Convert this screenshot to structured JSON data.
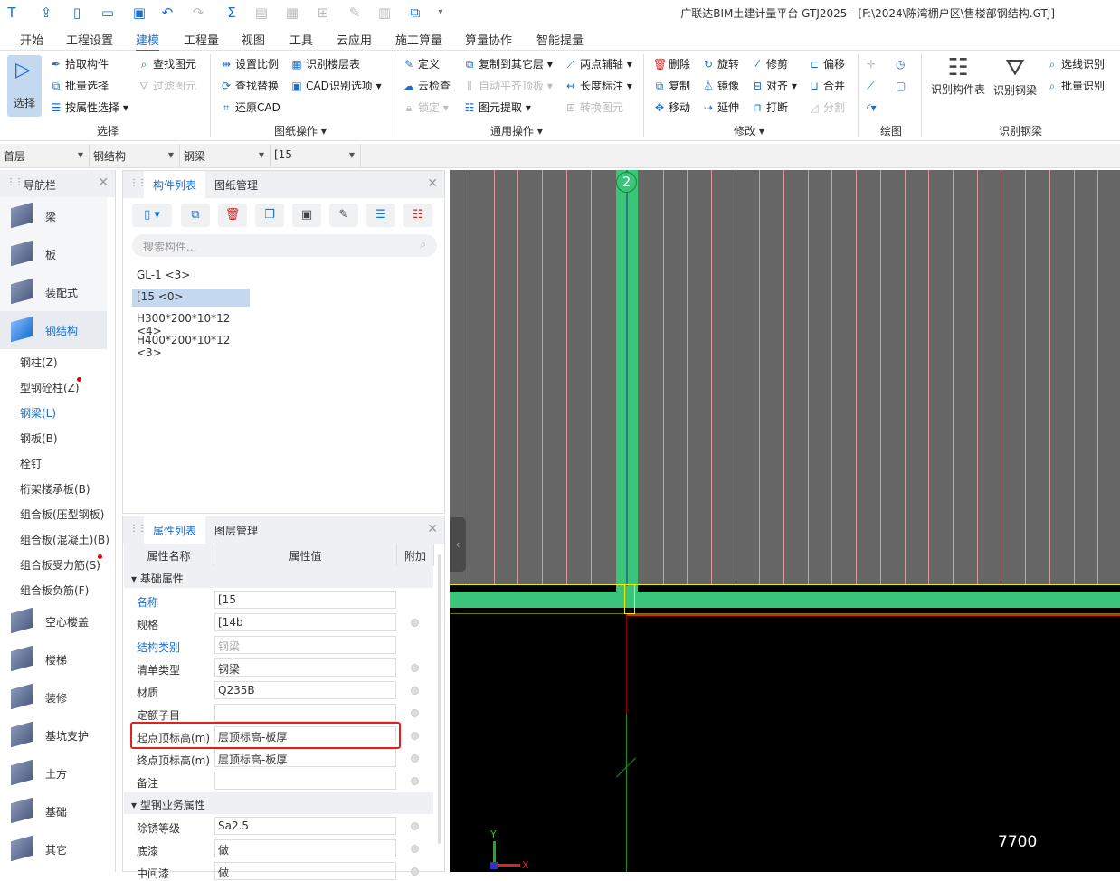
{
  "title": "广联达BIM土建计量平台 GTJ2025 - [F:\\2024\\陈湾棚户区\\售楼部钢结构.GTJ]",
  "quick_access": [
    "app-logo-icon",
    "upload-icon",
    "new-file-icon",
    "open-folder-icon",
    "save-icon",
    "undo-icon",
    "redo-icon",
    "sum-icon",
    "report-icon",
    "table-icon",
    "grid-icon",
    "pen-icon",
    "ruler-icon",
    "new-window-icon",
    "more-icon"
  ],
  "menu_tabs": [
    "开始",
    "工程设置",
    "建模",
    "工程量",
    "视图",
    "工具",
    "云应用",
    "施工算量",
    "算量协作",
    "智能提量"
  ],
  "ribbon": {
    "select": {
      "big": "选择",
      "items": [
        "拾取构件",
        "批量选择",
        "按属性选择",
        "查找图元",
        "过滤图元"
      ],
      "group": "选择"
    },
    "drawing": {
      "items": [
        "设置比例",
        "识别楼层表",
        "查找替换",
        "CAD识别选项",
        "还原CAD"
      ],
      "group": "图纸操作"
    },
    "general": {
      "items": [
        "定义",
        "复制到其它层",
        "两点辅轴",
        "云检查",
        "自动平齐顶板",
        "长度标注",
        "锁定",
        "图元提取",
        "转换图元"
      ],
      "group": "通用操作"
    },
    "modify": {
      "items": [
        "删除",
        "旋转",
        "修剪",
        "偏移",
        "复制",
        "镜像",
        "对齐",
        "合并",
        "移动",
        "延伸",
        "打断",
        "分割"
      ],
      "group": "修改"
    },
    "draw": {
      "group": "绘图"
    },
    "recognize": {
      "items": [
        "识别构件表",
        "识别钢梁",
        "选线识别",
        "批量识别"
      ],
      "group": "识别钢梁"
    }
  },
  "combos": [
    "首层",
    "钢结构",
    "钢梁",
    "[15"
  ],
  "nav": {
    "title": "导航栏",
    "big": [
      "梁",
      "板",
      "装配式",
      "钢结构"
    ],
    "sub": [
      "钢柱(Z)",
      "型钢砼柱(Z)",
      "钢梁(L)",
      "钢板(B)",
      "栓钉",
      "桁架楼承板(B)",
      "组合板(压型钢板)",
      "组合板(混凝土)(B)",
      "组合板受力筋(S)",
      "组合板负筋(F)"
    ],
    "big2": [
      "空心楼盖",
      "楼梯",
      "装修",
      "基坑支护",
      "土方",
      "基础",
      "其它"
    ]
  },
  "comp": {
    "tabs": [
      "构件列表",
      "图纸管理"
    ],
    "search_placeholder": "搜索构件...",
    "items": [
      "GL-1 <3>",
      "[15 <0>",
      "H300*200*10*12 <4>",
      "H400*200*10*12 <3>"
    ]
  },
  "props": {
    "tabs": [
      "属性列表",
      "图层管理"
    ],
    "headers": [
      "属性名称",
      "属性值",
      "附加"
    ],
    "sections": [
      "基础属性",
      "型钢业务属性"
    ],
    "rows": [
      {
        "name": "名称",
        "value": "[15"
      },
      {
        "name": "规格",
        "value": "[14b"
      },
      {
        "name": "结构类别",
        "value": "钢梁"
      },
      {
        "name": "清单类型",
        "value": "钢梁"
      },
      {
        "name": "材质",
        "value": "Q235B"
      },
      {
        "name": "定额子目",
        "value": ""
      },
      {
        "name": "起点顶标高(m)",
        "value": "层顶标高-板厚"
      },
      {
        "name": "终点顶标高(m)",
        "value": "层顶标高-板厚"
      },
      {
        "name": "备注",
        "value": ""
      }
    ],
    "rows2": [
      {
        "name": "除锈等级",
        "value": "Sa2.5"
      },
      {
        "name": "底漆",
        "value": "做"
      },
      {
        "name": "中间漆",
        "value": "做"
      }
    ]
  },
  "canvas": {
    "axis_label": "2",
    "dimension": "7700",
    "axis_y": "Y",
    "axis_x": "X"
  },
  "colors": {
    "accent": "#1a6fd0",
    "beam": "#3cc47a",
    "highlight": "#e02020"
  }
}
